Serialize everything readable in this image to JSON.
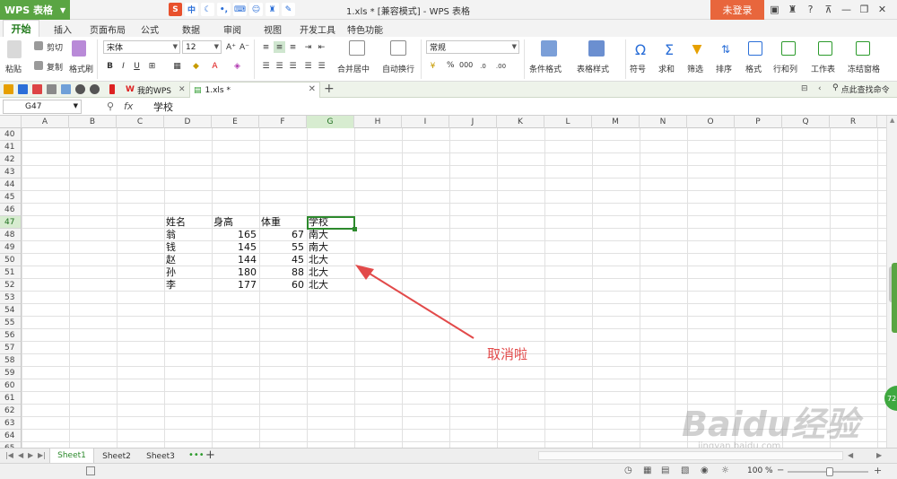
{
  "app": {
    "name": "WPS 表格",
    "doc_title": "1.xls * [兼容模式] - WPS 表格",
    "login": "未登录"
  },
  "menu": {
    "tabs": [
      "开始",
      "插入",
      "页面布局",
      "公式",
      "数据",
      "审阅",
      "视图",
      "开发工具",
      "特色功能"
    ]
  },
  "ribbon": {
    "cut": "剪切",
    "paste": "粘贴",
    "copy": "复制",
    "format_painter": "格式刷",
    "font_name": "宋体",
    "font_size": "12",
    "merge_center": "合并居中",
    "wrap_text": "自动换行",
    "number_format": "常规",
    "conditional_format": "条件格式",
    "table_style": "表格样式",
    "symbol": "符号",
    "sum": "求和",
    "filter": "筛选",
    "sort": "排序",
    "format": "格式",
    "row_col": "行和列",
    "worksheet": "工作表",
    "freeze": "冻结窗格",
    "percent": "%",
    "thousands": "000"
  },
  "doc_tabs": {
    "my_wps": "我的WPS",
    "file": "1.xls *",
    "search_cmd": "点此查找命令"
  },
  "formula_bar": {
    "cell_ref": "G47",
    "fx": "fx",
    "content": "学校"
  },
  "grid": {
    "columns": [
      "A",
      "B",
      "C",
      "D",
      "E",
      "F",
      "G",
      "H",
      "I",
      "J",
      "K",
      "L",
      "M",
      "N",
      "O",
      "P",
      "Q",
      "R"
    ],
    "rows": [
      "40",
      "41",
      "42",
      "43",
      "44",
      "45",
      "46",
      "47",
      "48",
      "49",
      "50",
      "51",
      "52",
      "53",
      "54",
      "55",
      "56",
      "57",
      "58",
      "59",
      "60",
      "61",
      "62",
      "63",
      "64",
      "65"
    ],
    "selected_column": "G",
    "selected_row": "47",
    "table": {
      "headers": [
        "姓名",
        "身高",
        "体重",
        "学校"
      ],
      "rows": [
        [
          "翁",
          "165",
          "67",
          "南大"
        ],
        [
          "钱",
          "145",
          "55",
          "南大"
        ],
        [
          "赵",
          "144",
          "45",
          "北大"
        ],
        [
          "孙",
          "180",
          "88",
          "北大"
        ],
        [
          "李",
          "177",
          "60",
          "北大"
        ]
      ]
    }
  },
  "annotation": {
    "text": "取消啦",
    "color": "#e24a4a"
  },
  "sheets": [
    "Sheet1",
    "Sheet2",
    "Sheet3"
  ],
  "status": {
    "zoom": "100 %"
  },
  "watermark": {
    "main": "Baidu经验",
    "sub": "jingyan.baidu.com"
  },
  "side_badge": "72"
}
